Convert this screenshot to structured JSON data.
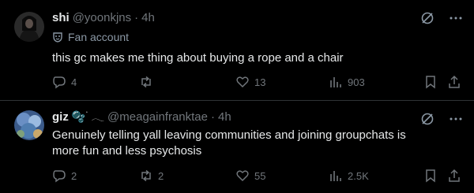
{
  "tweets": [
    {
      "name": "shi",
      "handle": "@yoonkjns",
      "dot": "·",
      "time": "4h",
      "community": "Fan account",
      "emojis": "",
      "text": "this gc makes me thing about buying a rope and a chair",
      "replies": "4",
      "retweets": "",
      "likes": "13",
      "views": "903"
    },
    {
      "name": "giz",
      "handle": "@meagainfranktae",
      "dot": "·",
      "time": "4h",
      "community": "",
      "emojis": "🫧 ࣪ 𓂃",
      "text": "Genuinely telling yall leaving communities and joining groupchats is more fun and less psychosis",
      "replies": "2",
      "retweets": "2",
      "likes": "55",
      "views": "2.5K"
    }
  ],
  "colors": {
    "background": "#000000",
    "text": "#e7e9ea",
    "muted": "#71767b",
    "divider": "#2f3336"
  },
  "icons": [
    "grok-icon",
    "more-icon",
    "reply-icon",
    "retweet-icon",
    "like-icon",
    "views-icon",
    "bookmark-icon",
    "share-icon",
    "community-mask-icon"
  ]
}
